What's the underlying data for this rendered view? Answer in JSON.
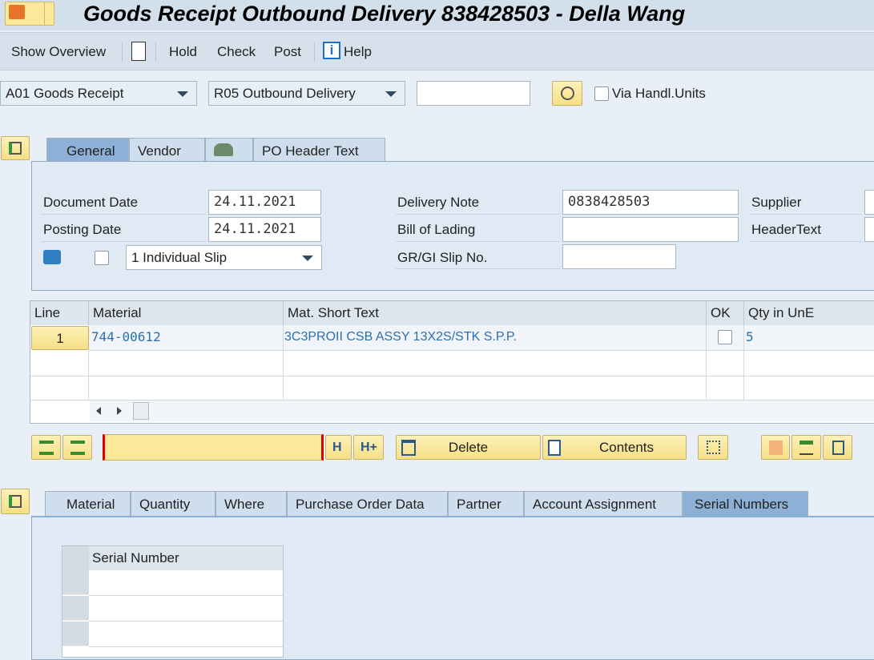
{
  "title": "Goods Receipt Outbound Delivery 838428503 - Della Wang",
  "toolbar": {
    "show_overview": "Show Overview",
    "hold": "Hold",
    "check": "Check",
    "post": "Post",
    "help": "Help"
  },
  "selection": {
    "action": "A01 Goods Receipt",
    "reference": "R05 Outbound Delivery",
    "document_number": "",
    "via_handling_units": "Via Handl.Units"
  },
  "header_tabs": [
    "General",
    "Vendor",
    "",
    "PO Header Text"
  ],
  "general": {
    "document_date_label": "Document Date",
    "document_date": "24.11.2021",
    "posting_date_label": "Posting Date",
    "posting_date": "24.11.2021",
    "slip_option": "1 Individual Slip",
    "delivery_note_label": "Delivery Note",
    "delivery_note": "0838428503",
    "bill_of_lading_label": "Bill of Lading",
    "bill_of_lading": "",
    "grgi_slip_label": "GR/GI Slip No.",
    "grgi_slip": "",
    "supplier_label": "Supplier",
    "header_text_label": "HeaderText"
  },
  "items": {
    "columns": [
      "Line",
      "Material",
      "Mat. Short Text",
      "OK",
      "Qty in UnE"
    ],
    "rows": [
      {
        "line": "1",
        "material": "744-00612",
        "text": "3C3PROII CSB ASSY 13X2S/STK S.P.P.",
        "qty": "5"
      }
    ]
  },
  "item_toolbar": {
    "search_value": "",
    "delete": "Delete",
    "contents": "Contents"
  },
  "detail_tabs": [
    "Material",
    "Quantity",
    "Where",
    "Purchase Order Data",
    "Partner",
    "Account Assignment",
    "Serial Numbers"
  ],
  "serial": {
    "column": "Serial Number"
  }
}
